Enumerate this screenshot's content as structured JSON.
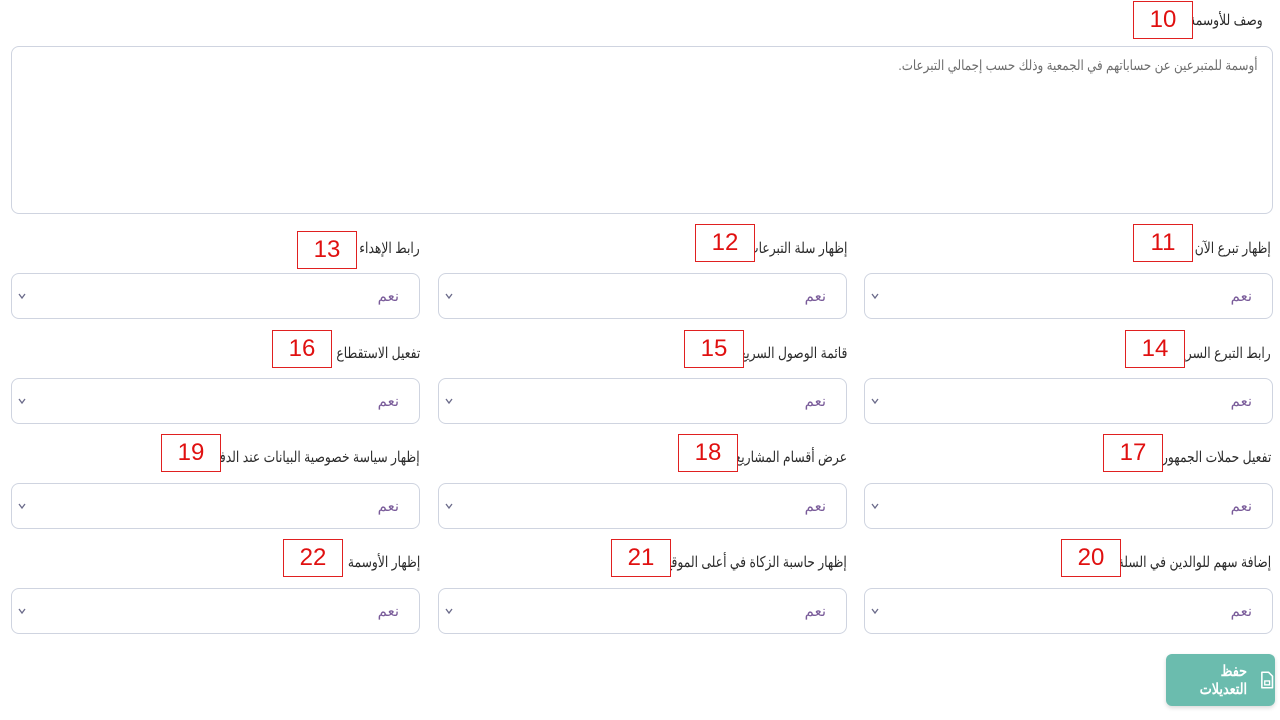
{
  "description_field": {
    "label": "وصف للأوسمة",
    "badge": "10",
    "value": "أوسمة للمتبرعين عن حساباتهم في الجمعية وذلك حسب إجمالي التبرعات."
  },
  "fields": [
    {
      "label": "إظهار تبرع الآن",
      "badge": "11",
      "value": "نعم"
    },
    {
      "label": "إظهار سلة التبرعات",
      "badge": "12",
      "value": "نعم"
    },
    {
      "label": "رابط الإهداء",
      "badge": "13",
      "value": "نعم"
    },
    {
      "label": "رابط التبرع السريع",
      "badge": "14",
      "value": "نعم"
    },
    {
      "label": "قائمة الوصول السريع",
      "badge": "15",
      "value": "نعم"
    },
    {
      "label": "تفعيل الاستقطاع",
      "badge": "16",
      "value": "نعم"
    },
    {
      "label": "تفعيل حملات الجمهور",
      "badge": "17",
      "value": "نعم"
    },
    {
      "label": "عرض أقسام المشاريع",
      "badge": "18",
      "value": "نعم"
    },
    {
      "label": "إظهار سياسة خصوصية البيانات عند الدفع",
      "badge": "19",
      "value": "نعم"
    },
    {
      "label": "إضافة سهم للوالدين في السلة",
      "badge": "20",
      "value": "نعم"
    },
    {
      "label": "إظهار حاسبة الزكاة في أعلى الموقع",
      "badge": "21",
      "value": "نعم"
    },
    {
      "label": "إظهار الأوسمة",
      "badge": "22",
      "value": "نعم"
    }
  ],
  "save_button": {
    "label": "حفظ التعديلات",
    "icon": "file-icon"
  },
  "colors": {
    "save_button_bg": "#6bbcae",
    "badge_red": "#e01010",
    "select_value": "#7a5c9a"
  }
}
